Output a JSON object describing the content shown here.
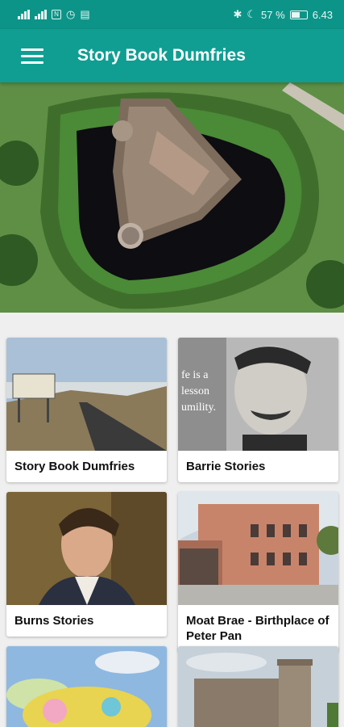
{
  "status": {
    "time": "6.43",
    "battery_percent": "57 %",
    "battery_level": 0.57,
    "sim_label": "1",
    "nfc_label": "N"
  },
  "appbar": {
    "title": "Story Book Dumfries",
    "menu_icon": "hamburger-menu-icon"
  },
  "hero": {
    "image": "aerial view of moated triangular castle ruin"
  },
  "cards": [
    {
      "id": "story-book-dumfries",
      "label": "Story Book Dumfries"
    },
    {
      "id": "barrie-stories",
      "label": "Barrie Stories",
      "image_text": "fe is a\nlesson\numility."
    },
    {
      "id": "burns-stories",
      "label": "Burns Stories"
    },
    {
      "id": "moat-brae",
      "label": "Moat Brae - Birthplace of Peter Pan"
    },
    {
      "id": "colour-card",
      "label": ""
    },
    {
      "id": "castle-card",
      "label": ""
    }
  ],
  "colors": {
    "statusbar": "#0d9488",
    "appbar": "#109e92",
    "background": "#efefef"
  }
}
